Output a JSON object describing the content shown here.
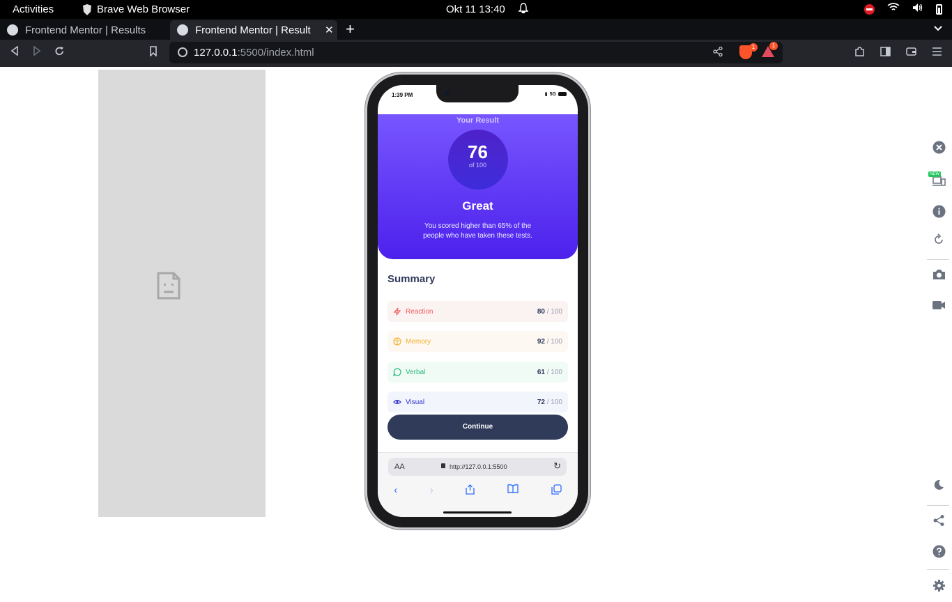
{
  "os_bar": {
    "activities": "Activities",
    "app_name": "Brave Web Browser",
    "clock": "Okt 11  13:40"
  },
  "tabs": [
    {
      "title": "Frontend Mentor | Results su",
      "active": false
    },
    {
      "title": "Frontend Mentor | Result",
      "active": true
    }
  ],
  "toolbar": {
    "url_host": "127.0.0.1",
    "url_rest": ":5500/index.html",
    "shield_badge": "1",
    "rewards_badge": "1"
  },
  "phone": {
    "status_time": "1:39 PM",
    "status_network": "5G",
    "result": {
      "label": "Your Result",
      "score": "76",
      "out_of": "of 100",
      "grade": "Great",
      "description": "You scored higher than 65% of the people who have taken these tests."
    },
    "summary": {
      "title": "Summary",
      "items": [
        {
          "name": "Reaction",
          "score": "80",
          "total": " / 100",
          "color": "#f55c5c",
          "bg": "#fbf2f2",
          "icon": "bolt-icon"
        },
        {
          "name": "Memory",
          "score": "92",
          "total": " / 100",
          "color": "#f5b130",
          "bg": "#fdf8f1",
          "icon": "brain-icon"
        },
        {
          "name": "Verbal",
          "score": "61",
          "total": " / 100",
          "color": "#22b87a",
          "bg": "#f1fbf6",
          "icon": "chat-icon"
        },
        {
          "name": "Visual",
          "score": "72",
          "total": " / 100",
          "color": "#2b2ec9",
          "bg": "#f3f5fd",
          "icon": "eye-icon"
        }
      ]
    },
    "continue_label": "Continue",
    "safari": {
      "aa": "AA",
      "address": "http://127.0.0.1:5500"
    }
  },
  "devtools": {
    "new_badge": "NEW"
  }
}
